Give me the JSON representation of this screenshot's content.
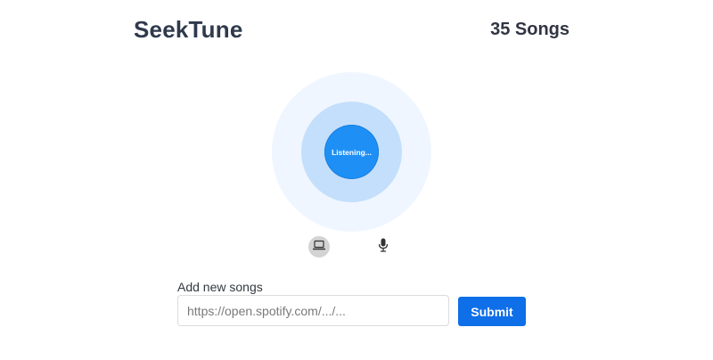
{
  "header": {
    "app_title": "SeekTune",
    "song_count": "35 Songs"
  },
  "listener": {
    "status_label": "Listening...",
    "modes": [
      {
        "name": "device-audio",
        "icon": "laptop-icon",
        "selected": true
      },
      {
        "name": "microphone",
        "icon": "microphone-icon",
        "selected": false
      }
    ]
  },
  "add_songs": {
    "label": "Add new songs",
    "input_value": "",
    "input_placeholder": "https://open.spotify.com/.../...",
    "submit_label": "Submit"
  },
  "colors": {
    "accent": "#1e90f5",
    "submit": "#0e6fe8",
    "ring_outer": "#eff6ff",
    "ring_mid": "#c4dffb",
    "title": "#2f3a4c"
  }
}
